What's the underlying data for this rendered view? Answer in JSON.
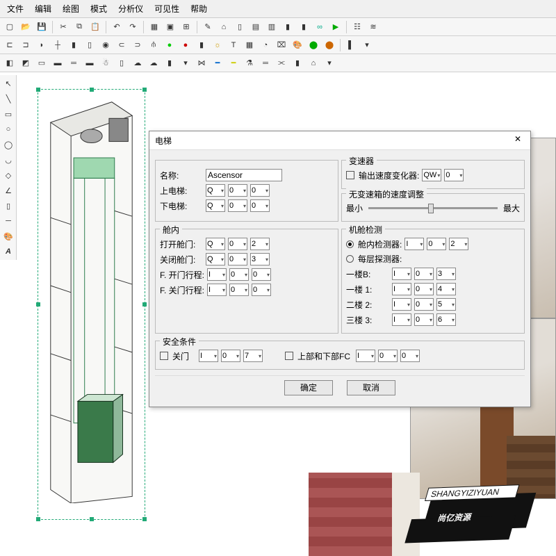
{
  "menu": {
    "items": [
      "文件",
      "编辑",
      "绘图",
      "模式",
      "分析仪",
      "可见性",
      "帮助"
    ]
  },
  "dialog": {
    "title": "电梯",
    "name_label": "名称:",
    "name_value": "Ascensor",
    "up_label": "上电梯:",
    "down_label": "下电梯:",
    "cabin_title": "舱内",
    "open_door": "打开舱门:",
    "close_door": "关闭舱门:",
    "f_open": "F. 开门行程:",
    "f_close": "F. 关门行程:",
    "gear_title": "变速器",
    "gear_chk": "输出速度变化器:",
    "speed_title": "无变速箱的速度调整",
    "min": "最小",
    "max": "最大",
    "detect_title": "机舱检测",
    "det_cabin": "舱内检测器:",
    "det_floor": "每层探测器:",
    "floorB": "一楼B:",
    "floor1": "一楼 1:",
    "floor2": "二楼 2:",
    "floor3": "三楼 3:",
    "safety_title": "安全条件",
    "close_gate": "关门",
    "top_bot": "上部和下部FC",
    "ok": "确定",
    "cancel": "取消",
    "vals": {
      "q": "Q",
      "i": "I",
      "qw": "QW",
      "z": "0",
      "n2": "2",
      "n3": "3",
      "n4": "4",
      "n5": "5",
      "n6": "6",
      "n7": "7"
    }
  },
  "watermark": {
    "pinyin": "SHANGYIZIYUAN",
    "cn": "尚亿资源"
  }
}
